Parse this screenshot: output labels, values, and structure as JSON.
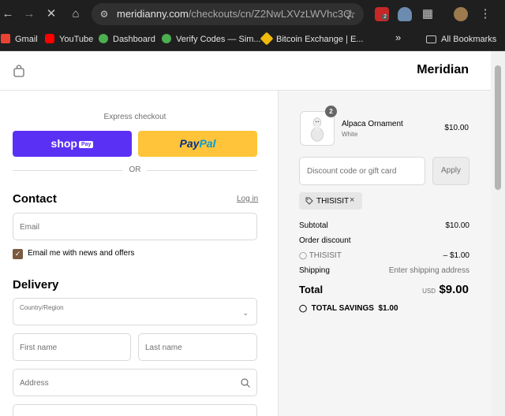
{
  "browser": {
    "url_host": "meridianny.com",
    "url_path": "/checkouts/cn/Z2NwLXVzLWVhc3Q...",
    "ext_badge": "2"
  },
  "bookmarks": [
    {
      "label": "Gmail",
      "icon": "gmail-icon",
      "color": "#ea4335"
    },
    {
      "label": "YouTube",
      "icon": "youtube-icon",
      "color": "#ff0000"
    },
    {
      "label": "Dashboard",
      "icon": "green-check-icon",
      "color": "#4caf50"
    },
    {
      "label": "Verify Codes — Sim...",
      "icon": "green-check-icon",
      "color": "#4caf50"
    },
    {
      "label": "Bitcoin Exchange | E...",
      "icon": "binance-icon",
      "color": "#f0b90b"
    }
  ],
  "bookmarks_more": "»",
  "all_bookmarks": "All Bookmarks",
  "header": {
    "brand": "Meridian"
  },
  "express": {
    "title": "Express checkout",
    "shop_label": "shop",
    "shop_pay": "Pay",
    "paypal_a": "Pay",
    "paypal_b": "Pal",
    "or": "OR"
  },
  "contact": {
    "heading": "Contact",
    "login": "Log in",
    "email_placeholder": "Email",
    "newsletter": "Email me with news and offers"
  },
  "delivery": {
    "heading": "Delivery",
    "country_label": "Country/Region",
    "first_name": "First name",
    "last_name": "Last name",
    "address": "Address"
  },
  "summary": {
    "qty": "2",
    "product_name": "Alpaca Ornament",
    "product_variant": "White",
    "product_price": "$10.00",
    "discount_placeholder": "Discount code or gift card",
    "apply": "Apply",
    "code": "THISISIT",
    "subtotal_label": "Subtotal",
    "subtotal_value": "$10.00",
    "order_discount_label": "Order discount",
    "discount_code": "THISISIT",
    "discount_value": "– $1.00",
    "shipping_label": "Shipping",
    "shipping_value": "Enter shipping address",
    "total_label": "Total",
    "currency": "USD",
    "total_value": "$9.00",
    "savings_label": "TOTAL SAVINGS",
    "savings_value": "$1.00"
  }
}
